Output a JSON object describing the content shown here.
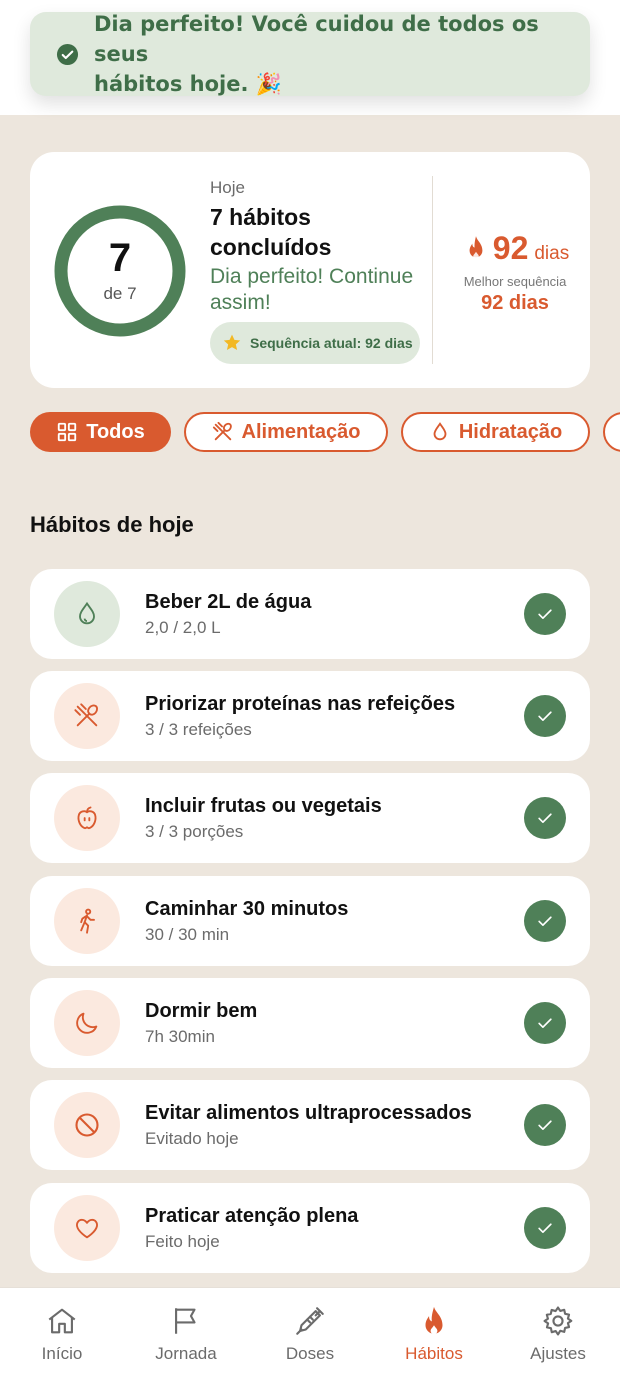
{
  "toast": {
    "line1": "Dia perfeito! Você cuidou de todos os seus",
    "line2": "hábitos hoje. 🎉",
    "icon": "check-circle-icon"
  },
  "summary": {
    "done_count": "7",
    "of_total": "de 7",
    "progress": 1.0,
    "today_label": "Hoje",
    "title": "7 hábitos concluídos",
    "message": "Dia perfeito! Continue assim!",
    "streak_text": "Sequência atual: 92 dias",
    "best_number": "92",
    "best_unit": "dias",
    "best_label": "Melhor sequência",
    "best_value": "92 dias"
  },
  "filters": [
    {
      "label": "Todos",
      "icon": "grid-icon",
      "active": true
    },
    {
      "label": "Alimentação",
      "icon": "utensils-icon",
      "active": false
    },
    {
      "label": "Hidratação",
      "icon": "drop-icon",
      "active": false
    }
  ],
  "section_title": "Hábitos de hoje",
  "habits": [
    {
      "name": "Beber 2L de água",
      "progress": "2,0 / 2,0 L",
      "icon": "drop-icon",
      "done": true
    },
    {
      "name": "Priorizar proteínas nas refeições",
      "progress": "3 / 3 refeições",
      "icon": "utensils-icon",
      "done": true
    },
    {
      "name": "Incluir frutas ou vegetais",
      "progress": "3 / 3 porções",
      "icon": "apple-icon",
      "done": true
    },
    {
      "name": "Caminhar 30 minutos",
      "progress": "30 / 30 min",
      "icon": "walking-icon",
      "done": true
    },
    {
      "name": "Dormir bem",
      "progress": "7h 30min",
      "icon": "moon-icon",
      "done": true
    },
    {
      "name": "Evitar alimentos ultraprocessados",
      "progress": "Evitado hoje",
      "icon": "prohibited-icon",
      "done": true
    },
    {
      "name": "Praticar atenção plena",
      "progress": "Feito hoje",
      "icon": "heart-icon",
      "done": true
    }
  ],
  "nav": [
    {
      "label": "Início",
      "icon": "home-icon"
    },
    {
      "label": "Jornada",
      "icon": "flag-icon"
    },
    {
      "label": "Doses",
      "icon": "syringe-icon"
    },
    {
      "label": "Hábitos",
      "icon": "flame-icon",
      "active": true
    },
    {
      "label": "Ajustes",
      "icon": "gear-icon"
    }
  ],
  "colors": {
    "accent": "#d95a2f",
    "green": "#4f8058",
    "green_light": "#dfe9dc",
    "background": "#ede6dd"
  }
}
